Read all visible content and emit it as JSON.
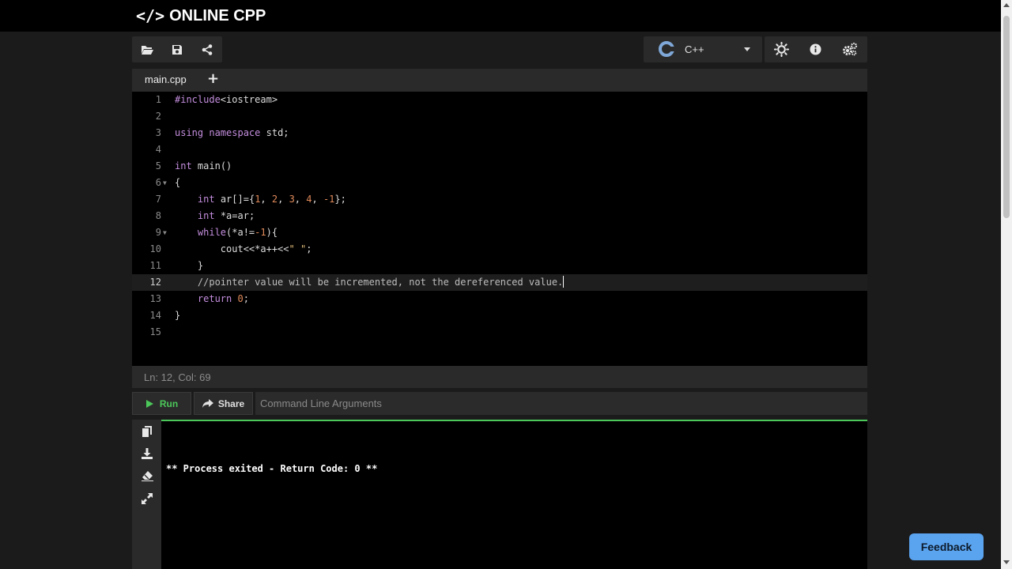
{
  "brand": {
    "mark": "</>",
    "name": "ONLINE CPP"
  },
  "toolbar": {
    "open_icon": "folder-open-icon",
    "save_icon": "save-icon",
    "share_icon": "share-icon"
  },
  "language": {
    "label": "C++",
    "icon": "cpp-logo-icon"
  },
  "settings": {
    "theme_icon": "sun-icon",
    "info_icon": "info-icon",
    "gear_icon": "gears-icon"
  },
  "tabs": [
    {
      "label": "main.cpp"
    }
  ],
  "tab_add": "+",
  "editor": {
    "active_line": 12,
    "lines": [
      {
        "n": "1"
      },
      {
        "n": "2"
      },
      {
        "n": "3"
      },
      {
        "n": "4"
      },
      {
        "n": "5"
      },
      {
        "n": "6"
      },
      {
        "n": "7"
      },
      {
        "n": "8"
      },
      {
        "n": "9"
      },
      {
        "n": "10"
      },
      {
        "n": "11"
      },
      {
        "n": "12"
      },
      {
        "n": "13"
      },
      {
        "n": "14"
      },
      {
        "n": "15"
      }
    ],
    "tokens": {
      "l1_a": "#include",
      "l1_b": "<iostream>",
      "l3_a": "using",
      "l3_b": "namespace",
      "l3_c": "std;",
      "l5_a": "int",
      "l5_b": "main()",
      "l6": "{",
      "l7_a": "int",
      "l7_b": "ar[]={",
      "l7_c": "1",
      "l7_d": "2",
      "l7_e": "3",
      "l7_f": "4",
      "l7_g": "-1",
      "l7_h": "};",
      "l8_a": "int",
      "l8_b": "*a=ar;",
      "l9_a": "while",
      "l9_b": "(*a!=",
      "l9_c": "-1",
      "l9_d": "){",
      "l10_a": "cout<<*a++<<",
      "l10_b": "\" \"",
      "l10_c": ";",
      "l11": "}",
      "l12": "//pointer value will be incremented, not the dereferenced value.",
      "l13_a": "return",
      "l13_b": "0",
      "l13_c": ";",
      "l14": "}"
    }
  },
  "status": {
    "text": "Ln: 12,  Col: 69"
  },
  "run": {
    "label": "Run"
  },
  "share": {
    "label": "Share"
  },
  "args": {
    "placeholder": "Command Line Arguments",
    "value": ""
  },
  "output": {
    "text": "** Process exited - Return Code: 0 **"
  },
  "output_tools": [
    "copy-icon",
    "download-icon",
    "eraser-icon",
    "expand-icon"
  ],
  "feedback": {
    "label": "Feedback"
  },
  "colors": {
    "accent_green": "#4cc85a",
    "feedback_blue": "#5aa3ef",
    "keyword": "#c48ede",
    "number": "#e08a5a"
  }
}
